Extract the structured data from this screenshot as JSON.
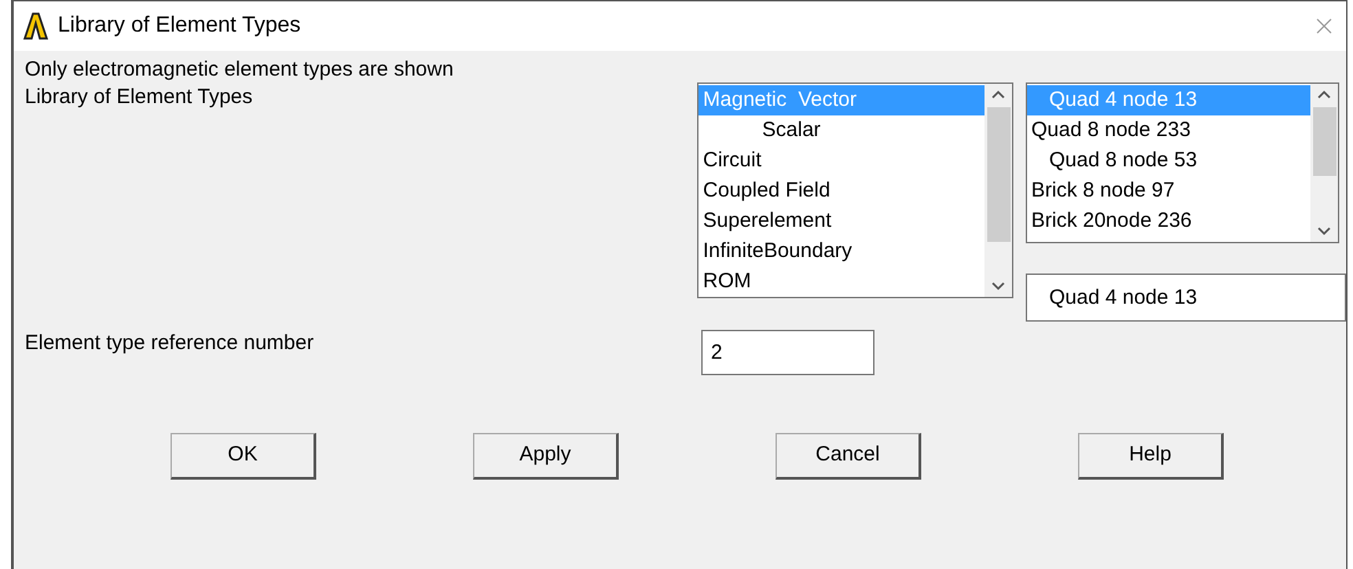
{
  "window": {
    "title": "Library of Element Types"
  },
  "note": "Only electromagnetic element types are shown",
  "library_label": "Library of Element Types",
  "category_list": {
    "items": [
      {
        "label": "Magnetic  Vector",
        "selected": true,
        "indented": false
      },
      {
        "label": "Scalar",
        "selected": false,
        "indented": true
      },
      {
        "label": "Circuit",
        "selected": false,
        "indented": false
      },
      {
        "label": "Coupled Field",
        "selected": false,
        "indented": false
      },
      {
        "label": "Superelement",
        "selected": false,
        "indented": false
      },
      {
        "label": "InfiniteBoundary",
        "selected": false,
        "indented": false
      },
      {
        "label": "ROM",
        "selected": false,
        "indented": false
      }
    ]
  },
  "type_list": {
    "items": [
      {
        "label": "Quad 4 node 13",
        "selected": true,
        "indented": true
      },
      {
        "label": "Quad 8 node 233",
        "selected": false,
        "indented": false
      },
      {
        "label": "Quad 8 node 53",
        "selected": false,
        "indented": true
      },
      {
        "label": "Brick 8 node 97",
        "selected": false,
        "indented": false
      },
      {
        "label": "Brick 20node 236",
        "selected": false,
        "indented": false
      }
    ]
  },
  "type_field": {
    "value": "Quad 4 node 13"
  },
  "reference": {
    "label": "Element type reference number",
    "value": "2"
  },
  "buttons": [
    "OK",
    "Apply",
    "Cancel",
    "Help"
  ]
}
